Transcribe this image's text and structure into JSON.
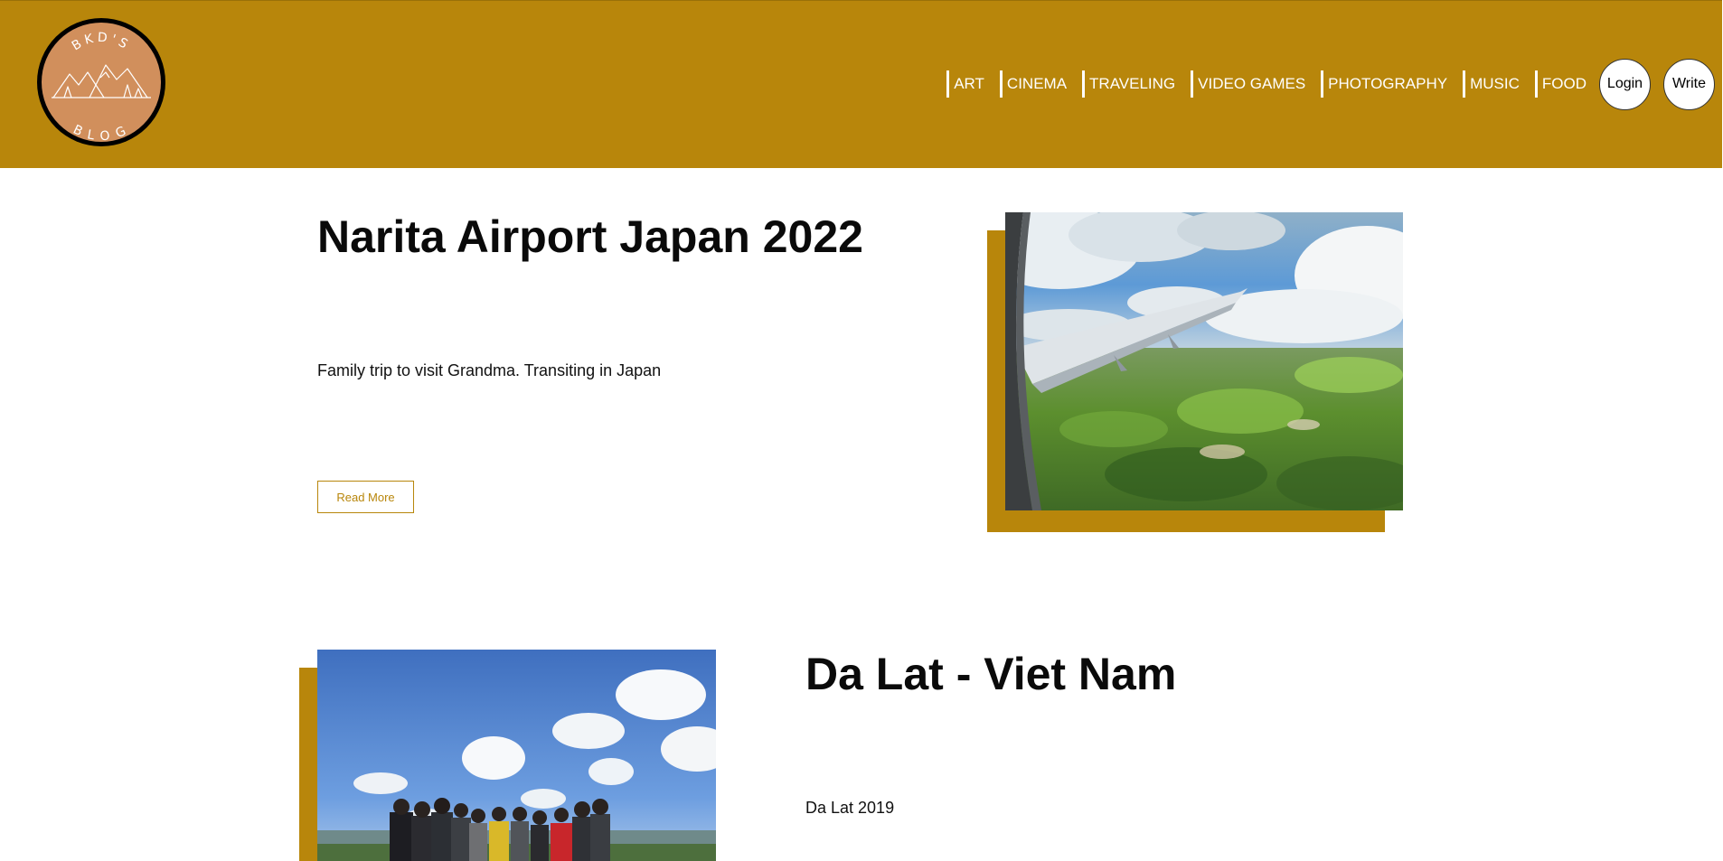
{
  "logo": {
    "top_text": "BKD'S",
    "bottom_text": "BLOG"
  },
  "nav": {
    "items": [
      "ART",
      "CINEMA",
      "TRAVELING",
      "VIDEO GAMES",
      "PHOTOGRAPHY",
      "MUSIC",
      "FOOD"
    ],
    "login_label": "Login",
    "write_label": "Write"
  },
  "posts": [
    {
      "title": "Narita Airport Japan 2022",
      "description": "Family trip to visit Grandma. Transiting in Japan",
      "read_more_label": "Read More"
    },
    {
      "title": "Da Lat - Viet Nam",
      "description": "Da Lat 2019"
    }
  ],
  "colors": {
    "accent": "#b8860b",
    "header_text": "#ffffff",
    "body_text": "#0a0a0a",
    "logo_fill": "#d18f5c"
  },
  "icons": {
    "logo_art": "mountains-and-pines-icon"
  }
}
